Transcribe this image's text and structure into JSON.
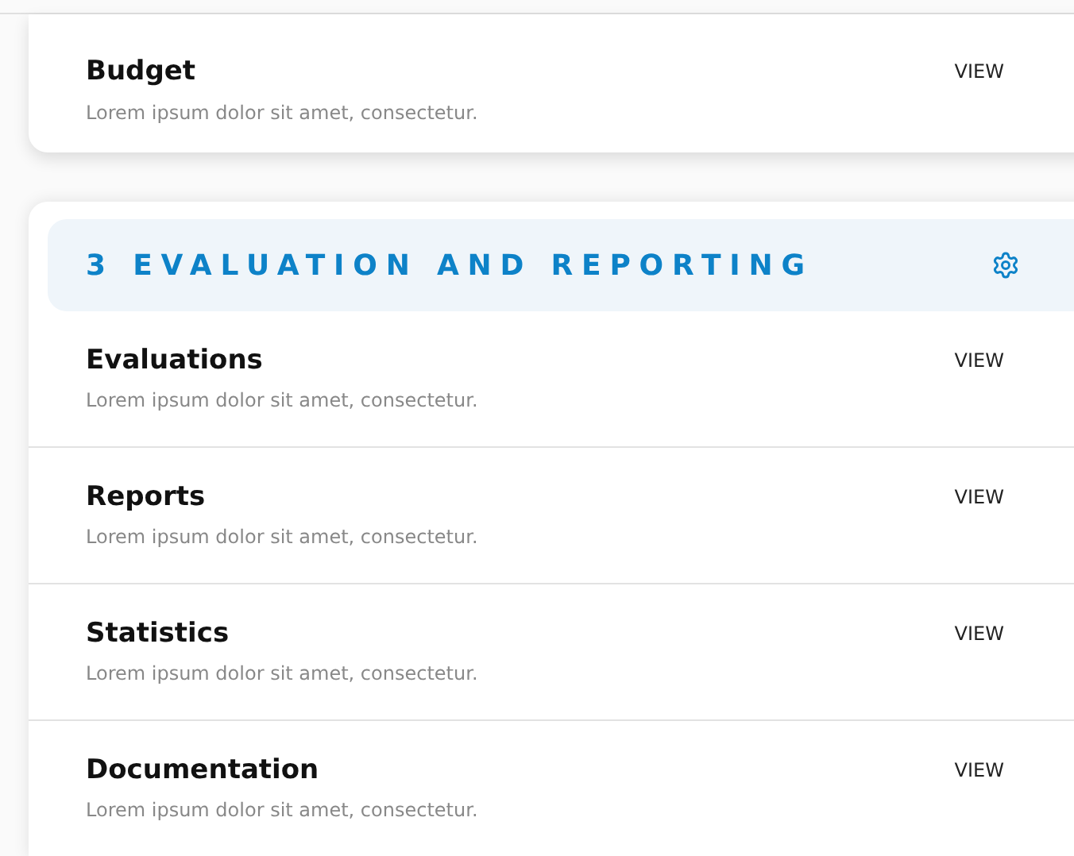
{
  "top_card": {
    "items": [
      {
        "title": "Budget",
        "description": "Lorem ipsum dolor sit amet, consectetur.",
        "action": "VIEW"
      }
    ]
  },
  "section": {
    "title": "3 EVALUATION AND REPORTING",
    "items": [
      {
        "title": "Evaluations",
        "description": "Lorem ipsum dolor sit amet, consectetur.",
        "action": "VIEW"
      },
      {
        "title": "Reports",
        "description": "Lorem ipsum dolor sit amet, consectetur.",
        "action": "VIEW"
      },
      {
        "title": "Statistics",
        "description": "Lorem ipsum dolor sit amet, consectetur.",
        "action": "VIEW"
      },
      {
        "title": "Documentation",
        "description": "Lorem ipsum dolor sit amet, consectetur.",
        "action": "VIEW"
      }
    ]
  }
}
